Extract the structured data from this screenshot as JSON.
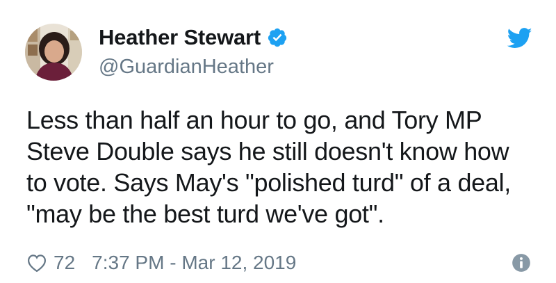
{
  "tweet": {
    "author": {
      "display_name": "Heather Stewart",
      "handle": "@GuardianHeather",
      "verified": true,
      "avatar_icon": "profile-photo"
    },
    "text_lines": [
      "Less than half an hour to go, and Tory MP",
      "Steve Double says he still doesn't know how",
      "to vote. Says May's \"polished turd\" of a deal,",
      "\"may be the best turd we've got\"."
    ],
    "likes": "72",
    "timestamp": "7:37 PM - Mar 12, 2019",
    "icons": {
      "verified": "verified-badge-icon",
      "platform": "twitter-bird-icon",
      "like": "heart-icon",
      "info": "info-icon"
    }
  },
  "colors": {
    "twitter_blue": "#1da1f2",
    "text_primary": "#14171a",
    "text_secondary": "#657786"
  }
}
